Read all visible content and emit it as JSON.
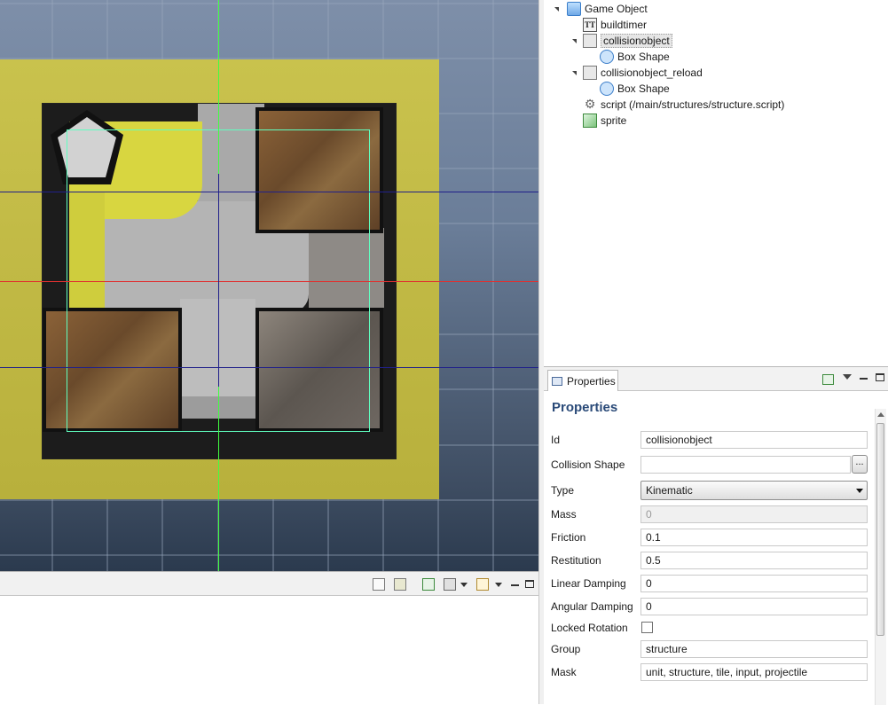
{
  "outline": {
    "root": {
      "label": "Game Object",
      "icon": "cube-icon"
    },
    "items": [
      {
        "label": "buildtimer",
        "icon": "text-tt-icon"
      },
      {
        "label": "collisionobject",
        "icon": "collision-object-icon",
        "selected": true
      },
      {
        "label": "Box Shape",
        "icon": "box-shape-icon"
      },
      {
        "label": "collisionobject_reload",
        "icon": "collision-object-icon"
      },
      {
        "label": "Box Shape",
        "icon": "box-shape-icon"
      },
      {
        "label": "script (/main/structures/structure.script)",
        "icon": "gear-icon"
      },
      {
        "label": "sprite",
        "icon": "sprite-icon"
      }
    ]
  },
  "properties": {
    "tab_label": "Properties",
    "title": "Properties",
    "browse_label": "...",
    "fields": {
      "id": {
        "label": "Id",
        "value": "collisionobject"
      },
      "collision_shape": {
        "label": "Collision Shape",
        "value": ""
      },
      "type": {
        "label": "Type",
        "value": "Kinematic"
      },
      "mass": {
        "label": "Mass",
        "value": "0"
      },
      "friction": {
        "label": "Friction",
        "value": "0.1"
      },
      "restitution": {
        "label": "Restitution",
        "value": "0.5"
      },
      "linear_damping": {
        "label": "Linear Damping",
        "value": "0"
      },
      "angular_damping": {
        "label": "Angular Damping",
        "value": "0"
      },
      "locked_rotation": {
        "label": "Locked Rotation",
        "checked": false
      },
      "group": {
        "label": "Group",
        "value": "structure"
      },
      "mask": {
        "label": "Mask",
        "value": "unit, structure, tile, input, projectile"
      }
    }
  },
  "colors": {
    "accent_title": "#2a4a78",
    "scene_background": "#6a7d98",
    "sprite_background": "#c8c04a",
    "grid_line": "#9aa8bd",
    "axis_x": "#e03030",
    "axis_y": "#40ff40",
    "aabb": "#60ffc0",
    "guide_line": "#20208a"
  }
}
